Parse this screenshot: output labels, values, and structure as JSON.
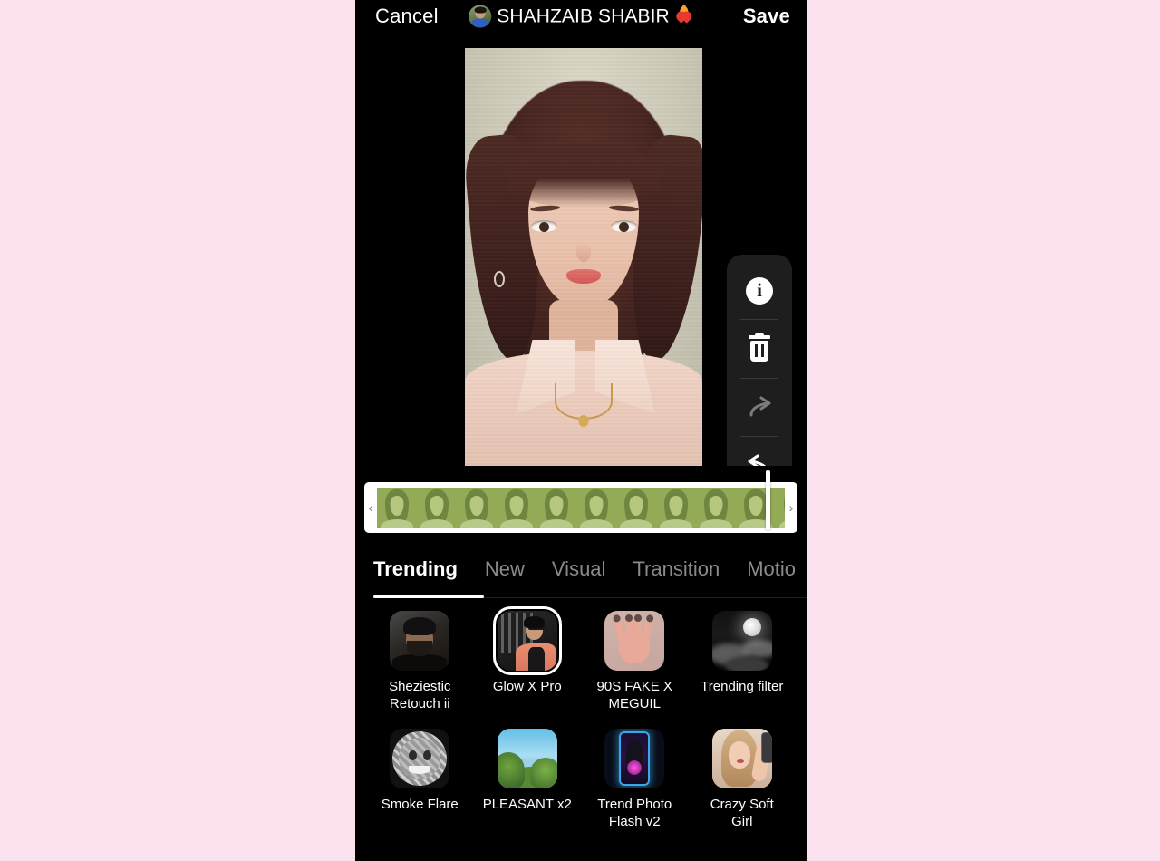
{
  "background_color": "#fce1ee",
  "phone": {
    "background_color": "#000000"
  },
  "topbar": {
    "cancel_label": "Cancel",
    "title": "SHAHZAIB SHABIR",
    "emoji_name": "heart-on-fire-emoji",
    "save_label": "Save",
    "avatar_name": "user-avatar"
  },
  "side_toolbar": {
    "buttons": [
      {
        "name": "info-icon",
        "label": "Info",
        "state": "enabled"
      },
      {
        "name": "trash-icon",
        "label": "Delete",
        "state": "enabled"
      },
      {
        "name": "redo-icon",
        "label": "Redo",
        "state": "disabled"
      },
      {
        "name": "undo-icon",
        "label": "Undo",
        "state": "enabled"
      }
    ]
  },
  "timeline": {
    "prev_chevron": "‹",
    "next_chevron": "›",
    "playhead_position_pct": 95,
    "frame_count": 11,
    "clip_tint": "#8ca54f"
  },
  "tabs": {
    "active_index": 0,
    "items": [
      {
        "label": "Trending"
      },
      {
        "label": "New"
      },
      {
        "label": "Visual"
      },
      {
        "label": "Transition"
      },
      {
        "label": "Motio"
      }
    ]
  },
  "filters": {
    "selected": "Glow X Pro",
    "items": [
      {
        "label": "Sheziestic\nRetouch ii",
        "art": "th-sheziestic",
        "selected": false
      },
      {
        "label": "Glow X Pro",
        "art": "th-glow",
        "selected": true
      },
      {
        "label": "90S FAKE X\nMEGUIL",
        "art": "th-hand",
        "selected": false
      },
      {
        "label": "Trending filter",
        "art": "th-moon",
        "selected": false
      },
      {
        "label": "Smoke Flare",
        "art": "th-smoke",
        "selected": false
      },
      {
        "label": "PLEASANT x2",
        "art": "th-pleasant",
        "selected": false
      },
      {
        "label": "Trend Photo\nFlash v2",
        "art": "th-flash",
        "selected": false
      },
      {
        "label": "Crazy Soft\nGirl",
        "art": "th-crazy",
        "selected": false
      }
    ]
  }
}
